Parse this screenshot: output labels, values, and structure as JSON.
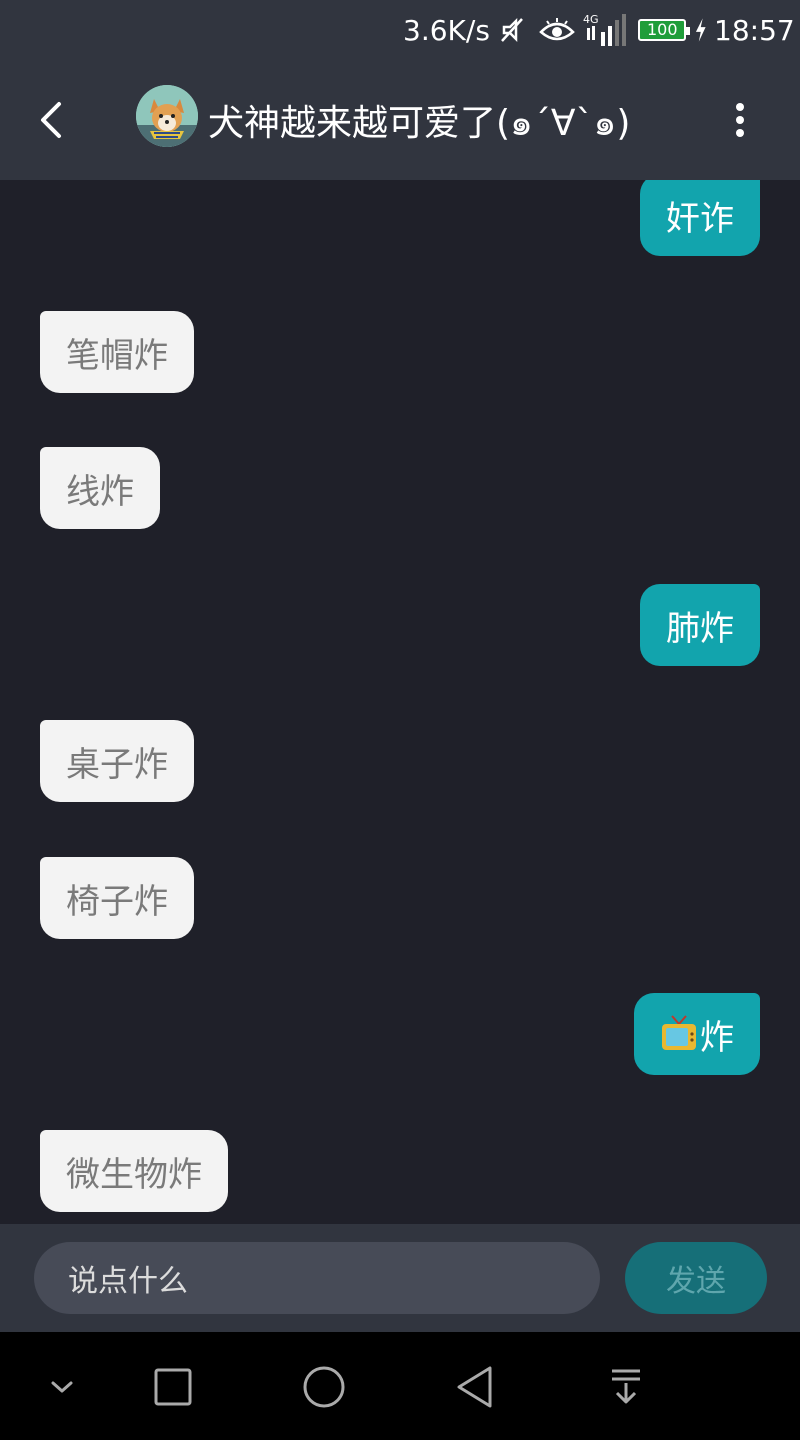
{
  "status_bar": {
    "net_speed": "3.6K/s",
    "network_type": "4G",
    "battery": "100",
    "time": "18:57",
    "icons": [
      "mute-icon",
      "eye-icon",
      "signal-icon",
      "battery-icon",
      "charging-icon"
    ]
  },
  "header": {
    "title": "犬神越来越可爱了(๑´∀`๑)",
    "back_icon": "chevron-left-icon",
    "more_icon": "more-vertical-icon",
    "avatar_icon": "shiba-avatar"
  },
  "messages": [
    {
      "side": "out",
      "text": "奸诈"
    },
    {
      "side": "in",
      "text": "笔帽炸"
    },
    {
      "side": "in",
      "text": "线炸"
    },
    {
      "side": "out",
      "text": "肺炸"
    },
    {
      "side": "in",
      "text": "桌子炸"
    },
    {
      "side": "in",
      "text": "椅子炸"
    },
    {
      "side": "out",
      "text": "炸",
      "emoji": "tv-icon"
    },
    {
      "side": "in",
      "text": "微生物炸"
    }
  ],
  "input": {
    "placeholder": "说点什么",
    "send_label": "发送"
  },
  "nav_bar": {
    "icons": [
      "chevron-down-icon",
      "recents-square-icon",
      "home-circle-icon",
      "back-triangle-icon",
      "notification-pull-down-icon"
    ]
  },
  "colors": {
    "bar_bg": "#31353f",
    "chat_bg": "#1f2029",
    "outgoing_bubble": "#12a4ad",
    "incoming_bubble": "#f3f3f3",
    "send_button": "#166f78"
  }
}
